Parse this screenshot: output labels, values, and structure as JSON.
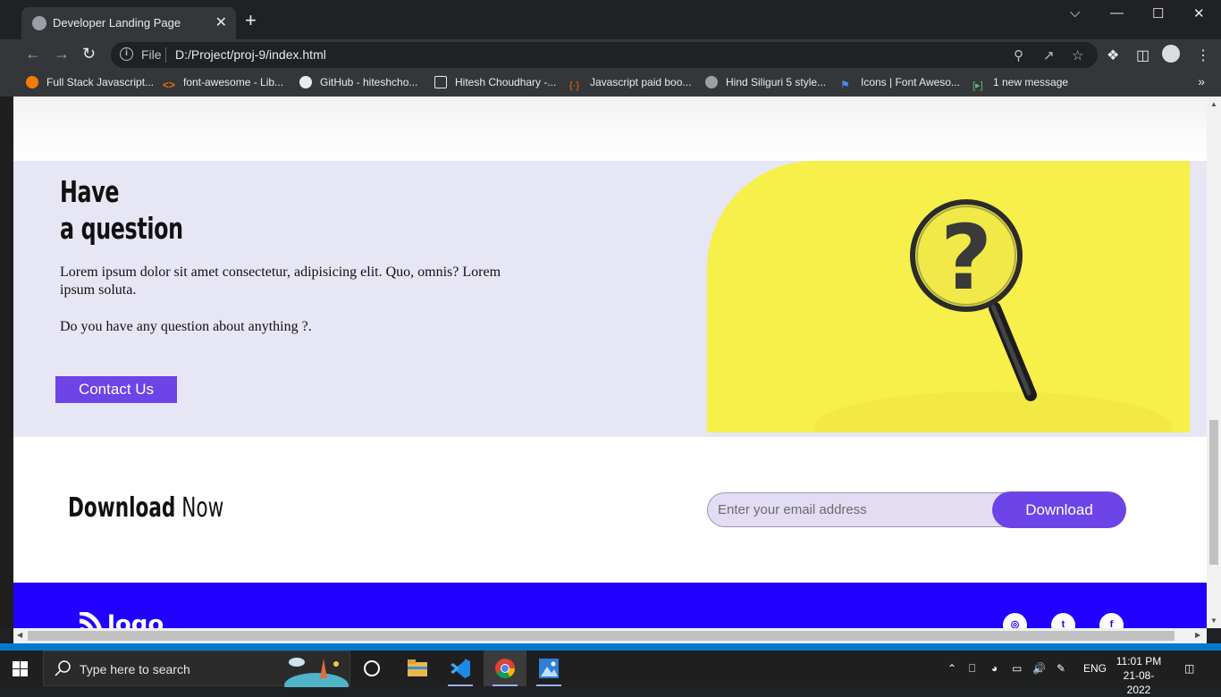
{
  "browser": {
    "tab_title": "Developer Landing Page",
    "tab_close": "✕",
    "new_tab": "+",
    "url_scheme": "File",
    "url": "D:/Project/proj-9/index.html",
    "window_controls": [
      "⌵",
      "—",
      "☐",
      "✕"
    ],
    "bookmarks": [
      {
        "label": "Full Stack Javascript...",
        "icon": "firebase-icon",
        "color": "#f57c00"
      },
      {
        "label": "font-awesome - Lib...",
        "icon": "code-icon",
        "color": "#e8710a"
      },
      {
        "label": "GitHub - hiteshcho...",
        "icon": "github-icon",
        "color": "#e8eaed"
      },
      {
        "label": "Hitesh Choudhary -...",
        "icon": "page-icon",
        "color": "#e8eaed"
      },
      {
        "label": "Javascript paid boo...",
        "icon": "brackets-icon",
        "color": "#e8710a"
      },
      {
        "label": "Hind Siliguri 5 style...",
        "icon": "globe-icon",
        "color": "#9aa0a6"
      },
      {
        "label": "Icons | Font Aweso...",
        "icon": "flag-icon",
        "color": "#4a8af4"
      },
      {
        "label": "1 new message",
        "icon": "chat-icon",
        "color": "#5bb974"
      }
    ],
    "bookmarks_more": "»"
  },
  "page": {
    "question": {
      "title_line1": "Have",
      "title_line2": "a question",
      "text": "Lorem ipsum dolor sit amet consectetur, adipisicing elit. Quo, omnis? Lorem ipsum soluta.",
      "text2": "Do you have any question about anything ?.",
      "cta": "Contact Us",
      "image_symbol": "?"
    },
    "download": {
      "title_bold": "Download",
      "title_thin": "Now",
      "email_placeholder": "Enter your email address",
      "button": "Download"
    },
    "footer": {
      "logo_text": "logo",
      "social": [
        "instagram-icon",
        "twitter-icon",
        "facebook-icon"
      ],
      "social_glyphs": [
        "◎",
        "t",
        "f"
      ]
    }
  },
  "colors": {
    "accent": "#6c44e8",
    "footer_blue": "#2200ff",
    "question_bg": "#e7e6f5",
    "yellow": "#f7ef4a"
  },
  "taskbar": {
    "search_placeholder": "Type here to search",
    "language": "ENG",
    "time": "11:01 PM",
    "date": "21-08-2022"
  }
}
